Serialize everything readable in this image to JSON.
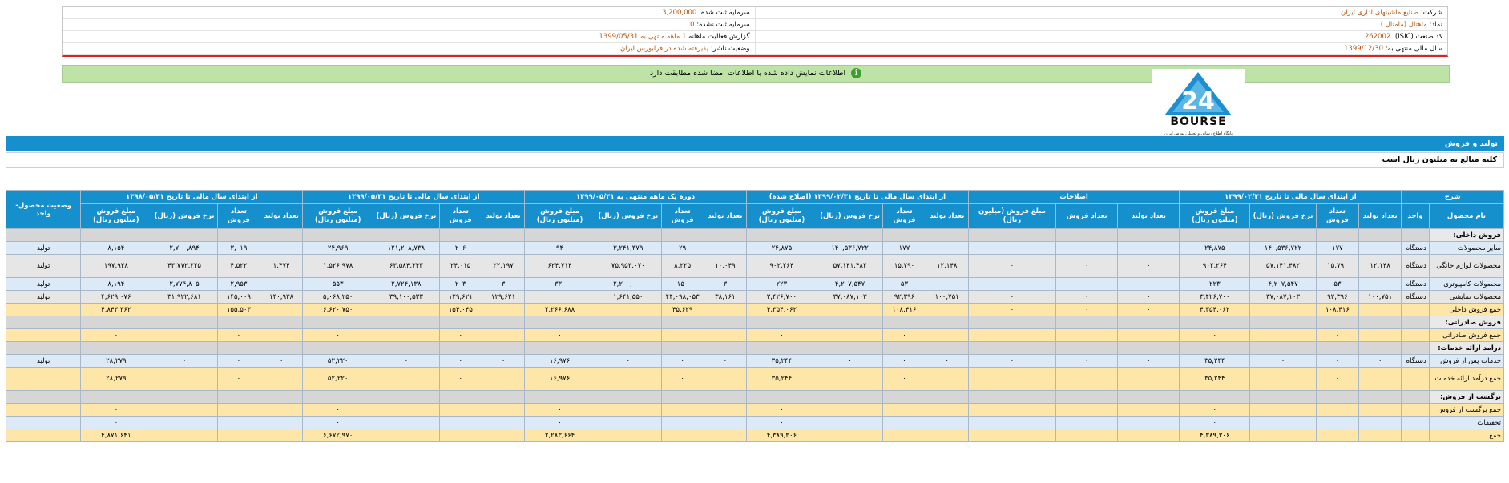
{
  "header": {
    "right_rows": [
      {
        "label": "شرکت:",
        "value": "صنایع ماشینهای اداری ایران"
      },
      {
        "label": "نماد:",
        "value": "ماهتال (مامتال )"
      },
      {
        "label": "کد صنعت (ISIC):",
        "value": "262002"
      },
      {
        "label": "سال مالی منتهی به:",
        "value": "1399/12/30"
      }
    ],
    "left_rows": [
      {
        "label": "سرمایه ثبت شده:",
        "value": "3,200,000"
      },
      {
        "label": "سرمایه ثبت نشده:",
        "value": "0"
      },
      {
        "label": "گزارش فعالیت ماهانه",
        "value": "1 ماهه منتهی به 1399/05/31"
      },
      {
        "label": "وضعیت ناشر:",
        "value": "پذیرفته شده در فرابورس ایران"
      }
    ]
  },
  "notice": {
    "text": "اطلاعات نمایش داده شده با اطلاعات امضا شده مطابقت دارد",
    "icon": "info-icon"
  },
  "logo": {
    "brand": "BOURSE",
    "tagline": "پایگاه اطلاع رسانی و تحلیلی بورس ایران"
  },
  "section": {
    "title": "تولید و فروش",
    "subtitle": "کلیه مبالغ به میلیون ریال است"
  },
  "table": {
    "group_headers": [
      "شرح",
      "از ابتدای سال مالی تا تاریخ ۱۳۹۹/۰۲/۳۱",
      "اصلاحات",
      "از ابتدای سال مالی تا تاریخ ۱۳۹۹/۰۲/۳۱ (اصلاح شده)",
      "دوره یک ماهه منتهی به ۱۳۹۹/۰۵/۳۱",
      "از ابتدای سال مالی تا تاریخ ۱۳۹۹/۰۵/۳۱",
      "از ابتدای سال مالی تا تاریخ ۱۳۹۸/۰۵/۳۱",
      "وضعیت محصول-واحد"
    ],
    "sub_headers": {
      "name": "نام محصول",
      "unit": "واحد",
      "full": [
        "تعداد تولید",
        "تعداد فروش",
        "نرخ فروش (ریال)",
        "مبلغ فروش (میلیون ریال)"
      ],
      "adj": [
        "تعداد تولید",
        "تعداد فروش",
        "مبلغ فروش (میلیون ریال)"
      ]
    },
    "rows": [
      {
        "type": "sect",
        "label": "فروش داخلی:"
      },
      {
        "type": "blue",
        "name": "سایر محصولات",
        "unit": "دستگاه",
        "c": [
          "۰",
          "۱۷۷",
          "۱۴۰,۵۳۶,۷۲۲",
          "۲۴,۸۷۵",
          "۰",
          "۰",
          "۰",
          "۰",
          "۱۷۷",
          "۱۴۰,۵۳۶,۷۲۲",
          "۲۴,۸۷۵",
          "۰",
          "۲۹",
          "۳,۲۴۱,۳۷۹",
          "۹۴",
          "۰",
          "۲۰۶",
          "۱۲۱,۲۰۸,۷۳۸",
          "۲۴,۹۶۹",
          "۰",
          "۳,۰۱۹",
          "۲,۷۰۰,۸۹۴",
          "۸,۱۵۴"
        ],
        "status": "تولید"
      },
      {
        "type": "grey tall",
        "name": "محصولات لوازم خانگی",
        "unit": "دستگاه",
        "c": [
          "۱۲,۱۴۸",
          "۱۵,۷۹۰",
          "۵۷,۱۴۱,۴۸۲",
          "۹۰۲,۲۶۴",
          "۰",
          "۰",
          "۰",
          "۱۲,۱۴۸",
          "۱۵,۷۹۰",
          "۵۷,۱۴۱,۴۸۲",
          "۹۰۲,۲۶۴",
          "۱۰,۰۴۹",
          "۸,۲۲۵",
          "۷۵,۹۵۳,۰۷۰",
          "۶۲۴,۷۱۴",
          "۲۲,۱۹۷",
          "۲۴,۰۱۵",
          "۶۳,۵۸۴,۳۴۳",
          "۱,۵۲۶,۹۷۸",
          "۱,۴۷۴",
          "۴,۵۲۲",
          "۴۳,۷۷۲,۲۲۵",
          "۱۹۷,۹۳۸"
        ],
        "status": "تولید"
      },
      {
        "type": "blue",
        "name": "محصولات کامپیوتری",
        "unit": "دستگاه",
        "c": [
          "۰",
          "۵۳",
          "۴,۲۰۷,۵۴۷",
          "۲۲۳",
          "۰",
          "۰",
          "۰",
          "۰",
          "۵۳",
          "۴,۲۰۷,۵۴۷",
          "۲۲۳",
          "۳",
          "۱۵۰",
          "۲,۲۰۰,۰۰۰",
          "۳۳۰",
          "۳",
          "۲۰۳",
          "۲,۷۲۴,۱۳۸",
          "۵۵۳",
          "۰",
          "۲,۹۵۳",
          "۲,۷۷۴,۸۰۵",
          "۸,۱۹۴"
        ],
        "status": "تولید"
      },
      {
        "type": "grey",
        "name": "محصولات نمایشی",
        "unit": "دستگاه",
        "c": [
          "۱۰۰,۷۵۱",
          "۹۲,۳۹۶",
          "۳۷,۰۸۷,۱۰۳",
          "۳,۴۲۶,۷۰۰",
          "۰",
          "۰",
          "۰",
          "۱۰۰,۷۵۱",
          "۹۲,۳۹۶",
          "۳۷,۰۸۷,۱۰۳",
          "۳,۴۲۶,۷۰۰",
          "۳۸,۱۶۱",
          "۴۴,۰۹۸,۰۵۳",
          "۱,۶۴۱,۵۵۰",
          "",
          "۱۲۹,۶۲۱",
          "۱۲۹,۶۲۱",
          "۳۹,۱۰۰,۵۳۳",
          "۵,۰۶۸,۲۵۰",
          "۱۴۰,۹۳۸",
          "۱۴۵,۰۰۹",
          "۳۱,۹۲۲,۶۸۱",
          "۴,۶۲۹,۰۷۶"
        ],
        "status": "تولید"
      },
      {
        "type": "tot",
        "name": "جمع فروش داخلی",
        "unit": "",
        "c": [
          "",
          "۱۰۸,۴۱۶",
          "",
          "۴,۳۵۴,۰۶۲",
          "۰",
          "۰",
          "۰",
          "",
          "۱۰۸,۴۱۶",
          "",
          "۴,۳۵۴,۰۶۲",
          "",
          "۴۵,۶۲۹",
          "",
          "۲,۲۶۶,۶۸۸",
          "",
          "۱۵۴,۰۴۵",
          "",
          "۶,۶۲۰,۷۵۰",
          "",
          "۱۵۵,۵۰۳",
          "",
          "۴,۸۴۳,۳۶۲"
        ],
        "status": ""
      },
      {
        "type": "sect",
        "label": "فروش صادراتی:"
      },
      {
        "type": "tot",
        "name": "جمع فروش صادراتی",
        "unit": "",
        "c": [
          "",
          "۰",
          "",
          "۰",
          "",
          "",
          "",
          "",
          "۰",
          "",
          "۰",
          "",
          "",
          "",
          "۰",
          "",
          "۰",
          "",
          "۰",
          "",
          "۰",
          "",
          "۰"
        ],
        "status": ""
      },
      {
        "type": "sect",
        "label": "درآمد ارائه خدمات:"
      },
      {
        "type": "blue",
        "name": "خدمات پس از فروش",
        "unit": "دستگاه",
        "c": [
          "۰",
          "۰",
          "۰",
          "۳۵,۲۴۴",
          "۰",
          "۰",
          "۰",
          "۰",
          "۰",
          "۰",
          "۳۵,۲۴۴",
          "۰",
          "۰",
          "۰",
          "۱۶,۹۷۶",
          "۰",
          "۰",
          "۰",
          "۵۲,۲۲۰",
          "۰",
          "۰",
          "۰",
          "۲۸,۲۷۹"
        ],
        "status": "تولید"
      },
      {
        "type": "tot tall",
        "name": "جمع درآمد ارائه خدمات",
        "unit": "",
        "c": [
          "",
          "۰",
          "",
          "۳۵,۲۴۴",
          "",
          "",
          "",
          "",
          "۰",
          "",
          "۳۵,۲۴۴",
          "",
          "۰",
          "",
          "۱۶,۹۷۶",
          "",
          "۰",
          "",
          "۵۲,۲۲۰",
          "",
          "۰",
          "",
          "۲۸,۲۷۹"
        ],
        "status": ""
      },
      {
        "type": "sect",
        "label": "برگشت از فروش:"
      },
      {
        "type": "tot",
        "name": "جمع برگشت از فروش",
        "unit": "",
        "c": [
          "",
          "",
          "",
          "۰",
          "",
          "",
          "",
          "",
          "",
          "",
          "۰",
          "",
          "",
          "",
          "۰",
          "",
          "",
          "",
          "۰",
          "",
          "",
          "",
          "۰"
        ],
        "status": ""
      },
      {
        "type": "blue",
        "name": "تخفیفات",
        "unit": "",
        "c": [
          "",
          "",
          "",
          "۰",
          "",
          "",
          "",
          "",
          "",
          "",
          "۰",
          "",
          "",
          "",
          "۰",
          "",
          "",
          "",
          "۰",
          "",
          "",
          "",
          "۰"
        ],
        "status": ""
      },
      {
        "type": "tot",
        "name": "جمع",
        "unit": "",
        "c": [
          "",
          "",
          "",
          "۴,۳۸۹,۳۰۶",
          "",
          "",
          "",
          "",
          "",
          "",
          "۴,۳۸۹,۳۰۶",
          "",
          "",
          "",
          "۲,۲۸۳,۶۶۴",
          "",
          "",
          "",
          "۶,۶۷۲,۹۷۰",
          "",
          "",
          "",
          "۴,۸۷۱,۶۴۱"
        ],
        "status": ""
      }
    ]
  }
}
